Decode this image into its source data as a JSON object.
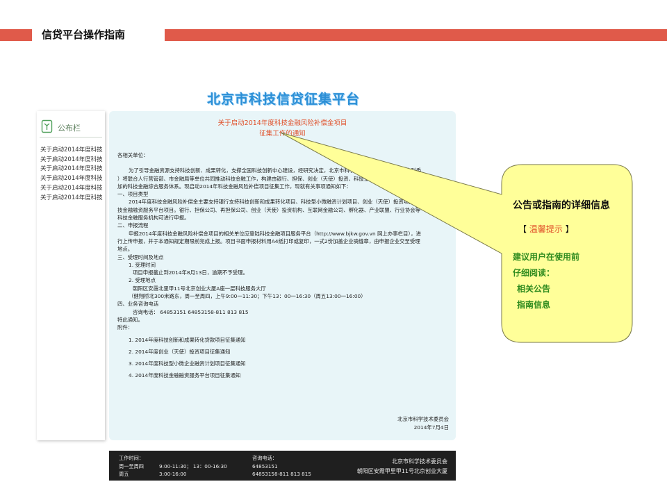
{
  "slide": {
    "title": "信贷平台操作指南",
    "accent_color": "#e05a4a"
  },
  "site": {
    "title": "北京市科技信贷征集平台",
    "title_color": "#2b8fd6"
  },
  "sidebar": {
    "header": "公布栏",
    "items": [
      "关于启动2014年度科技",
      "关于启动2014年度科技",
      "关于启动2014年度科技",
      "关于启动2014年度科技",
      "关于启动2014年度科技",
      "关于启动2014年度科技"
    ]
  },
  "notice": {
    "title_line1": "关于启动2014年度科技金融风险补偿金项目",
    "title_line2": "征集工作的通知",
    "title_color": "#e0502a",
    "background": "#e8f5f8",
    "salutation": "各相关单位：",
    "intro_lines": [
      "为了引导金融资源支持科技创新、成果转化，支撑全国科技创新中心建设，经研究决定，北京市科学技术委员会（以下简称市科委",
      "）将联合人行营管部、市金融局等单位共同推动科技金融工作，构建由银行、担保、创业（天使）投资、科技金融服务机构等共同参",
      "加的科技金融综合服务体系。现启动2014年科技金融风险补偿项目征集工作，现就有关事项通知如下："
    ],
    "section1_title": "一、项目类型",
    "section1_lines": [
      "2014年度科技金融风险补偿金主要支持银行支持科技创新和成果转化项目、科技型小微融资计划项目、创业（天使）投资项目和科",
      "技金融融资服务平台项目。银行、担保公司、再担保公司、创业（天使）投资机构、互联网金融公司、孵化器、产业联盟、行业协会等",
      "科技金融服务机构可进行申报。"
    ],
    "section2_title": "二、申报流程",
    "section2_lines": [
      "申报2014年度科技金融风险补偿金项目的相关单位应登陆科技金融项目服务平台（http://www.bjkw.gov.vn 网上办事栏目），进",
      "行上传申报，并于本通知规定期限前完成上报。项目书面申报材料用A4纸打印或复印，一式2份加盖企业骑缝章，由申报企业交至受理",
      "地点。"
    ],
    "section3_title": "三、受理时间及地点",
    "time_title": "1. 受理时间",
    "time_text": "项目申报截止到2014年8月13日，逾期不予受理。",
    "place_title": "2. 受理地点",
    "place_text": "朝阳区安霞北里甲11号北京创业大厦A座一层科技服务大厅",
    "place_hours": "（健翔桥北300米路东，周一至周四，上午9:00一11:30；下午13：00一16:30（周五13:00一16:00）",
    "section4_title": "四、业务咨询电话",
    "phone_text": "咨询电话：  64853151    64853158-811 813 815",
    "closing": "特此通知。",
    "attachments_title": "附件：",
    "attachments": [
      "1. 2014年度科技创新和成果转化贷款项目征集通知",
      "2. 2014年度创业（天使）投资项目征集通知",
      "3. 2014年度科技型小微企业融资计划项目征集通知",
      "4. 2014年度科技金融融资服务平台项目征集通知"
    ],
    "sign_org": "北京市科学技术委员会",
    "sign_date": "2014年7月4日"
  },
  "footer": {
    "hours_label": "工作时间：",
    "hours_row1_day": "周一至周四",
    "hours_row1_time": "9:00-11:30；  13：00-16:30",
    "hours_row2_day": "周五",
    "hours_row2_time": "3:00-16:00",
    "phone_label": "咨询电话：",
    "phone1": "64853151",
    "phone2": "64853158-811 813 815",
    "org": "北京市科学技术委员会",
    "address": "朝阳区安霞甲里甲11号北京创业大厦"
  },
  "callout": {
    "main": "公告或指南的详细信息",
    "tip_open": "【",
    "tip_word": "温馨提示",
    "tip_close": "】",
    "line1": "建议用户在使用前",
    "line2": "仔细阅读：",
    "line3": "相关公告",
    "line4": "指南信息",
    "fill_color": "#ffff99",
    "text_green": "#2e8b1e"
  }
}
